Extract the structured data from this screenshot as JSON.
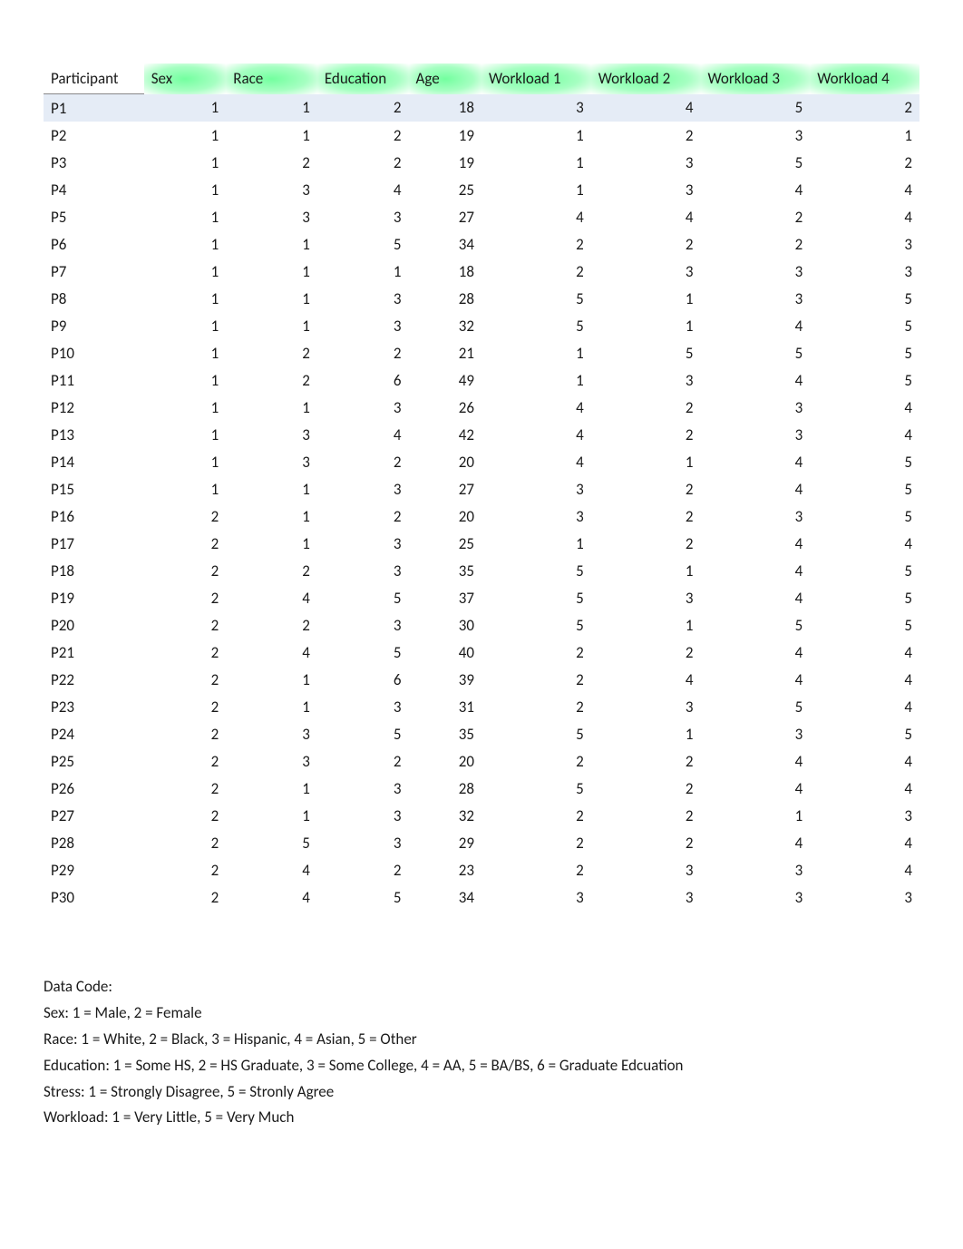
{
  "table": {
    "headers": {
      "participant": "Participant",
      "sex": "Sex",
      "race": "Race",
      "education": "Education",
      "age": "Age",
      "w1": "Workload 1",
      "w2": "Workload 2",
      "w3": "Workload 3",
      "w4": "Workload 4"
    },
    "rows": [
      {
        "participant": "P1",
        "sex": 1,
        "race": 1,
        "education": 2,
        "age": 18,
        "w1": 3,
        "w2": 4,
        "w3": 5,
        "w4": 2,
        "selected": true
      },
      {
        "participant": "P2",
        "sex": 1,
        "race": 1,
        "education": 2,
        "age": 19,
        "w1": 1,
        "w2": 2,
        "w3": 3,
        "w4": 1
      },
      {
        "participant": "P3",
        "sex": 1,
        "race": 2,
        "education": 2,
        "age": 19,
        "w1": 1,
        "w2": 3,
        "w3": 5,
        "w4": 2
      },
      {
        "participant": "P4",
        "sex": 1,
        "race": 3,
        "education": 4,
        "age": 25,
        "w1": 1,
        "w2": 3,
        "w3": 4,
        "w4": 4
      },
      {
        "participant": "P5",
        "sex": 1,
        "race": 3,
        "education": 3,
        "age": 27,
        "w1": 4,
        "w2": 4,
        "w3": 2,
        "w4": 4
      },
      {
        "participant": "P6",
        "sex": 1,
        "race": 1,
        "education": 5,
        "age": 34,
        "w1": 2,
        "w2": 2,
        "w3": 2,
        "w4": 3
      },
      {
        "participant": "P7",
        "sex": 1,
        "race": 1,
        "education": 1,
        "age": 18,
        "w1": 2,
        "w2": 3,
        "w3": 3,
        "w4": 3
      },
      {
        "participant": "P8",
        "sex": 1,
        "race": 1,
        "education": 3,
        "age": 28,
        "w1": 5,
        "w2": 1,
        "w3": 3,
        "w4": 5
      },
      {
        "participant": "P9",
        "sex": 1,
        "race": 1,
        "education": 3,
        "age": 32,
        "w1": 5,
        "w2": 1,
        "w3": 4,
        "w4": 5
      },
      {
        "participant": "P10",
        "sex": 1,
        "race": 2,
        "education": 2,
        "age": 21,
        "w1": 1,
        "w2": 5,
        "w3": 5,
        "w4": 5
      },
      {
        "participant": "P11",
        "sex": 1,
        "race": 2,
        "education": 6,
        "age": 49,
        "w1": 1,
        "w2": 3,
        "w3": 4,
        "w4": 5
      },
      {
        "participant": "P12",
        "sex": 1,
        "race": 1,
        "education": 3,
        "age": 26,
        "w1": 4,
        "w2": 2,
        "w3": 3,
        "w4": 4
      },
      {
        "participant": "P13",
        "sex": 1,
        "race": 3,
        "education": 4,
        "age": 42,
        "w1": 4,
        "w2": 2,
        "w3": 3,
        "w4": 4
      },
      {
        "participant": "P14",
        "sex": 1,
        "race": 3,
        "education": 2,
        "age": 20,
        "w1": 4,
        "w2": 1,
        "w3": 4,
        "w4": 5
      },
      {
        "participant": "P15",
        "sex": 1,
        "race": 1,
        "education": 3,
        "age": 27,
        "w1": 3,
        "w2": 2,
        "w3": 4,
        "w4": 5
      },
      {
        "participant": "P16",
        "sex": 2,
        "race": 1,
        "education": 2,
        "age": 20,
        "w1": 3,
        "w2": 2,
        "w3": 3,
        "w4": 5
      },
      {
        "participant": "P17",
        "sex": 2,
        "race": 1,
        "education": 3,
        "age": 25,
        "w1": 1,
        "w2": 2,
        "w3": 4,
        "w4": 4
      },
      {
        "participant": "P18",
        "sex": 2,
        "race": 2,
        "education": 3,
        "age": 35,
        "w1": 5,
        "w2": 1,
        "w3": 4,
        "w4": 5
      },
      {
        "participant": "P19",
        "sex": 2,
        "race": 4,
        "education": 5,
        "age": 37,
        "w1": 5,
        "w2": 3,
        "w3": 4,
        "w4": 5
      },
      {
        "participant": "P20",
        "sex": 2,
        "race": 2,
        "education": 3,
        "age": 30,
        "w1": 5,
        "w2": 1,
        "w3": 5,
        "w4": 5
      },
      {
        "participant": "P21",
        "sex": 2,
        "race": 4,
        "education": 5,
        "age": 40,
        "w1": 2,
        "w2": 2,
        "w3": 4,
        "w4": 4
      },
      {
        "participant": "P22",
        "sex": 2,
        "race": 1,
        "education": 6,
        "age": 39,
        "w1": 2,
        "w2": 4,
        "w3": 4,
        "w4": 4
      },
      {
        "participant": "P23",
        "sex": 2,
        "race": 1,
        "education": 3,
        "age": 31,
        "w1": 2,
        "w2": 3,
        "w3": 5,
        "w4": 4
      },
      {
        "participant": "P24",
        "sex": 2,
        "race": 3,
        "education": 5,
        "age": 35,
        "w1": 5,
        "w2": 1,
        "w3": 3,
        "w4": 5
      },
      {
        "participant": "P25",
        "sex": 2,
        "race": 3,
        "education": 2,
        "age": 20,
        "w1": 2,
        "w2": 2,
        "w3": 4,
        "w4": 4
      },
      {
        "participant": "P26",
        "sex": 2,
        "race": 1,
        "education": 3,
        "age": 28,
        "w1": 5,
        "w2": 2,
        "w3": 4,
        "w4": 4
      },
      {
        "participant": "P27",
        "sex": 2,
        "race": 1,
        "education": 3,
        "age": 32,
        "w1": 2,
        "w2": 2,
        "w3": 1,
        "w4": 3
      },
      {
        "participant": "P28",
        "sex": 2,
        "race": 5,
        "education": 3,
        "age": 29,
        "w1": 2,
        "w2": 2,
        "w3": 4,
        "w4": 4
      },
      {
        "participant": "P29",
        "sex": 2,
        "race": 4,
        "education": 2,
        "age": 23,
        "w1": 2,
        "w2": 3,
        "w3": 3,
        "w4": 4
      },
      {
        "participant": "P30",
        "sex": 2,
        "race": 4,
        "education": 5,
        "age": 34,
        "w1": 3,
        "w2": 3,
        "w3": 3,
        "w4": 3
      }
    ]
  },
  "codes": {
    "title": "Data Code:",
    "sex": "Sex: 1 = Male, 2 = Female",
    "race": "Race: 1 = White, 2 = Black, 3 = Hispanic, 4 = Asian, 5 = Other",
    "education": "Education: 1 = Some HS, 2 = HS Graduate, 3 = Some College, 4 = AA, 5 = BA/BS, 6 = Graduate Edcuation",
    "stress": "Stress: 1 = Strongly Disagree, 5 = Stronly Agree",
    "workload": "Workload: 1 = Very Little, 5 = Very Much"
  }
}
